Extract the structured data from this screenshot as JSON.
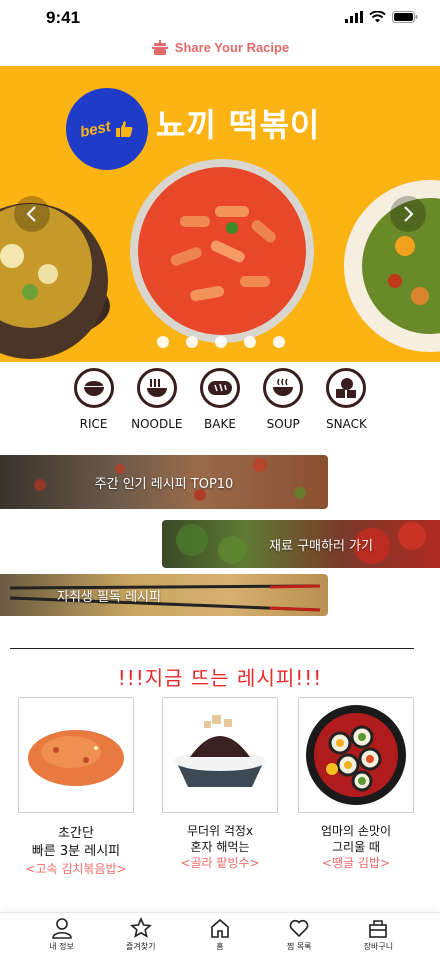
{
  "status": {
    "time": "9:41"
  },
  "header": {
    "title": "Share Your Racipe",
    "accent": "#e36b6b"
  },
  "banner": {
    "title": "뇨끼 떡볶이",
    "badge": "best",
    "background": "#fbb414",
    "dots_count": 5,
    "prev_icon": "chevron-left-icon",
    "next_icon": "chevron-right-icon"
  },
  "categories": [
    {
      "label": "RICE",
      "icon": "rice-bowl-icon"
    },
    {
      "label": "NOODLE",
      "icon": "noodle-bowl-icon"
    },
    {
      "label": "BAKE",
      "icon": "bread-icon"
    },
    {
      "label": "SOUP",
      "icon": "soup-bowl-icon"
    },
    {
      "label": "SNACK",
      "icon": "snack-icon"
    }
  ],
  "menu": {
    "weekly_top": "주간 인기 레시피 TOP10",
    "buy_ingredients": "재료 구매하러 가기",
    "student_recipes": "자취생 필독 레시피"
  },
  "hot": {
    "title": "!!!지금 뜨는 레시피!!!",
    "title_color": "#ea2b2b",
    "recipes": [
      {
        "line1": "초간단",
        "line2": "빠른 3분 레시피",
        "name": "<고속 김치볶음밥>"
      },
      {
        "line1": "무더위 걱정x",
        "line2": "혼자 해먹는",
        "name": "<골라 팥빙수>"
      },
      {
        "line1": "엄마의 손맛이",
        "line2": "그리울 때",
        "name": "<땡글 김밥>"
      }
    ]
  },
  "nav": [
    {
      "label": "내 정보",
      "icon": "user-icon"
    },
    {
      "label": "즐겨찾기",
      "icon": "star-icon"
    },
    {
      "label": "홈",
      "icon": "home-icon"
    },
    {
      "label": "찜 목록",
      "icon": "heart-icon"
    },
    {
      "label": "장바구니",
      "icon": "basket-icon"
    }
  ]
}
